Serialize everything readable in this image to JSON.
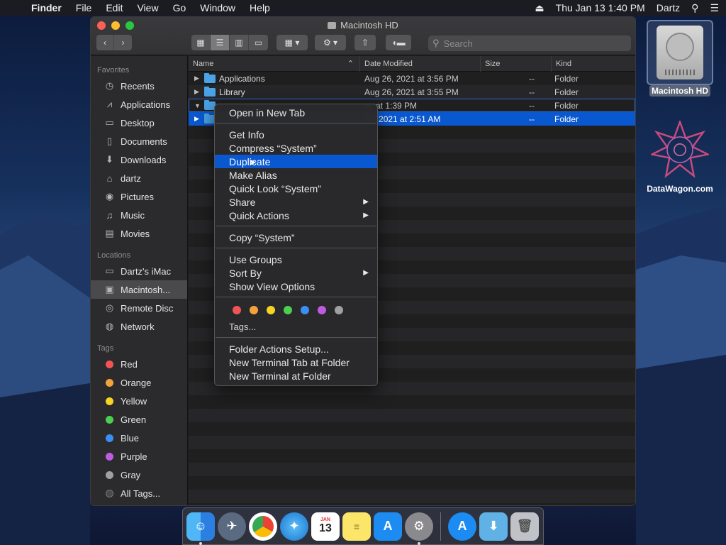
{
  "menubar": {
    "app": "Finder",
    "items": [
      "File",
      "Edit",
      "View",
      "Go",
      "Window",
      "Help"
    ],
    "datetime": "Thu Jan 13  1:40 PM",
    "user": "Dartz"
  },
  "window": {
    "title": "Macintosh HD",
    "search_placeholder": "Search"
  },
  "sidebar": {
    "favorites_header": "Favorites",
    "favorites": [
      "Recents",
      "Applications",
      "Desktop",
      "Documents",
      "Downloads",
      "dartz",
      "Pictures",
      "Music",
      "Movies"
    ],
    "locations_header": "Locations",
    "locations": [
      "Dartz's iMac",
      "Macintosh...",
      "Remote Disc",
      "Network"
    ],
    "tags_header": "Tags",
    "tags": [
      {
        "label": "Red",
        "color": "#f15454"
      },
      {
        "label": "Orange",
        "color": "#f3a33c"
      },
      {
        "label": "Yellow",
        "color": "#f5d426"
      },
      {
        "label": "Green",
        "color": "#4bcf4e"
      },
      {
        "label": "Blue",
        "color": "#3a8ff5"
      },
      {
        "label": "Purple",
        "color": "#be5ce0"
      },
      {
        "label": "Gray",
        "color": "#a0a0a0"
      },
      {
        "label": "All Tags...",
        "color": "#4a4a4a"
      }
    ]
  },
  "columns": {
    "name": "Name",
    "date": "Date Modified",
    "size": "Size",
    "kind": "Kind"
  },
  "files": [
    {
      "name": "Applications",
      "date": "Aug 26, 2021 at 3:56 PM",
      "size": "--",
      "kind": "Folder"
    },
    {
      "name": "Library",
      "date": "Aug 26, 2021 at 3:55 PM",
      "size": "--",
      "kind": "Folder"
    },
    {
      "name": "",
      "date": "ay at 1:39 PM",
      "size": "--",
      "kind": "Folder"
    },
    {
      "name": "",
      "date": " 26, 2021 at 2:51 AM",
      "size": "--",
      "kind": "Folder"
    }
  ],
  "context_menu": {
    "open_new_tab": "Open in New Tab",
    "get_info": "Get Info",
    "compress": "Compress “System”",
    "duplicate": "Duplicate",
    "make_alias": "Make Alias",
    "quick_look": "Quick Look “System”",
    "share": "Share",
    "quick_actions": "Quick Actions",
    "copy": "Copy “System”",
    "use_groups": "Use Groups",
    "sort_by": "Sort By",
    "show_view_options": "Show View Options",
    "tag_colors": [
      "#f15454",
      "#f3a33c",
      "#f5d426",
      "#4bcf4e",
      "#3a8ff5",
      "#be5ce0",
      "#a0a0a0"
    ],
    "tags": "Tags...",
    "folder_actions": "Folder Actions Setup...",
    "new_terminal_tab": "New Terminal Tab at Folder",
    "new_terminal": "New Terminal at Folder"
  },
  "desktop": {
    "hd_label": "Macintosh HD",
    "dw_label": "DataWagon.com"
  },
  "dock": {
    "calendar_day": "13",
    "calendar_month": "JAN"
  }
}
